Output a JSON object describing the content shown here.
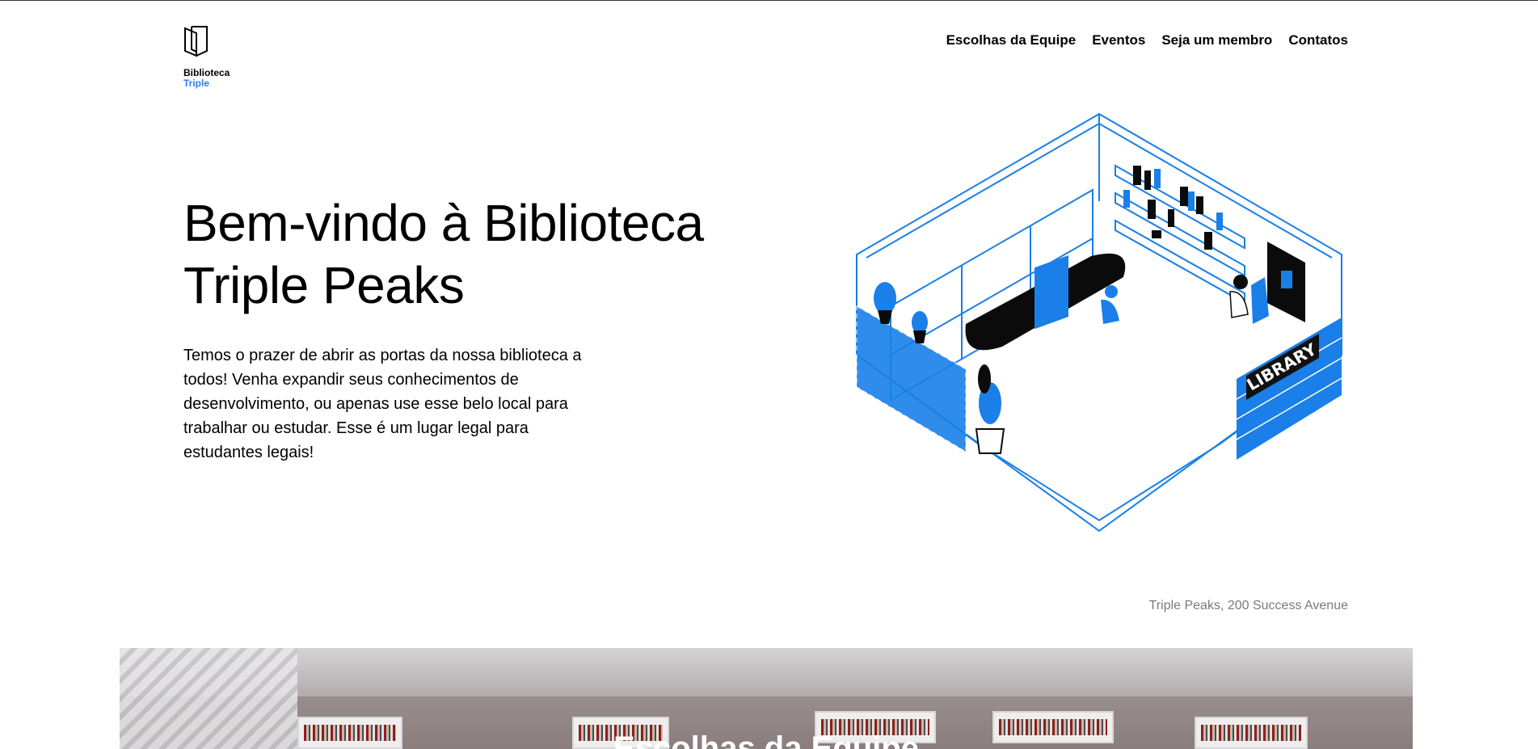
{
  "header": {
    "logo": {
      "line1": "Biblioteca",
      "line2": "Triple",
      "icon": "book-logo-icon"
    },
    "nav": [
      {
        "label": "Escolhas da Equipe"
      },
      {
        "label": "Eventos"
      },
      {
        "label": "Seja um membro"
      },
      {
        "label": "Contatos"
      }
    ]
  },
  "hero": {
    "title": "Bem-vindo à Biblioteca Triple Peaks",
    "text": "Temos o prazer de abrir as portas da nossa biblioteca a todos! Venha expandir seus conhecimentos de desenvolvimento, ou apenas use esse belo local para trabalhar ou estudar. Esse é um lugar legal para estudantes legais!",
    "illustration": {
      "sign": "LIBRARY",
      "accent": "#1a7fe8"
    }
  },
  "address": "Triple Peaks, 200 Success Avenue",
  "banner": {
    "title": "Escolhas da Equipe"
  },
  "colors": {
    "accent": "#2f80ed",
    "text": "#000000",
    "muted": "#7a7a7a"
  }
}
